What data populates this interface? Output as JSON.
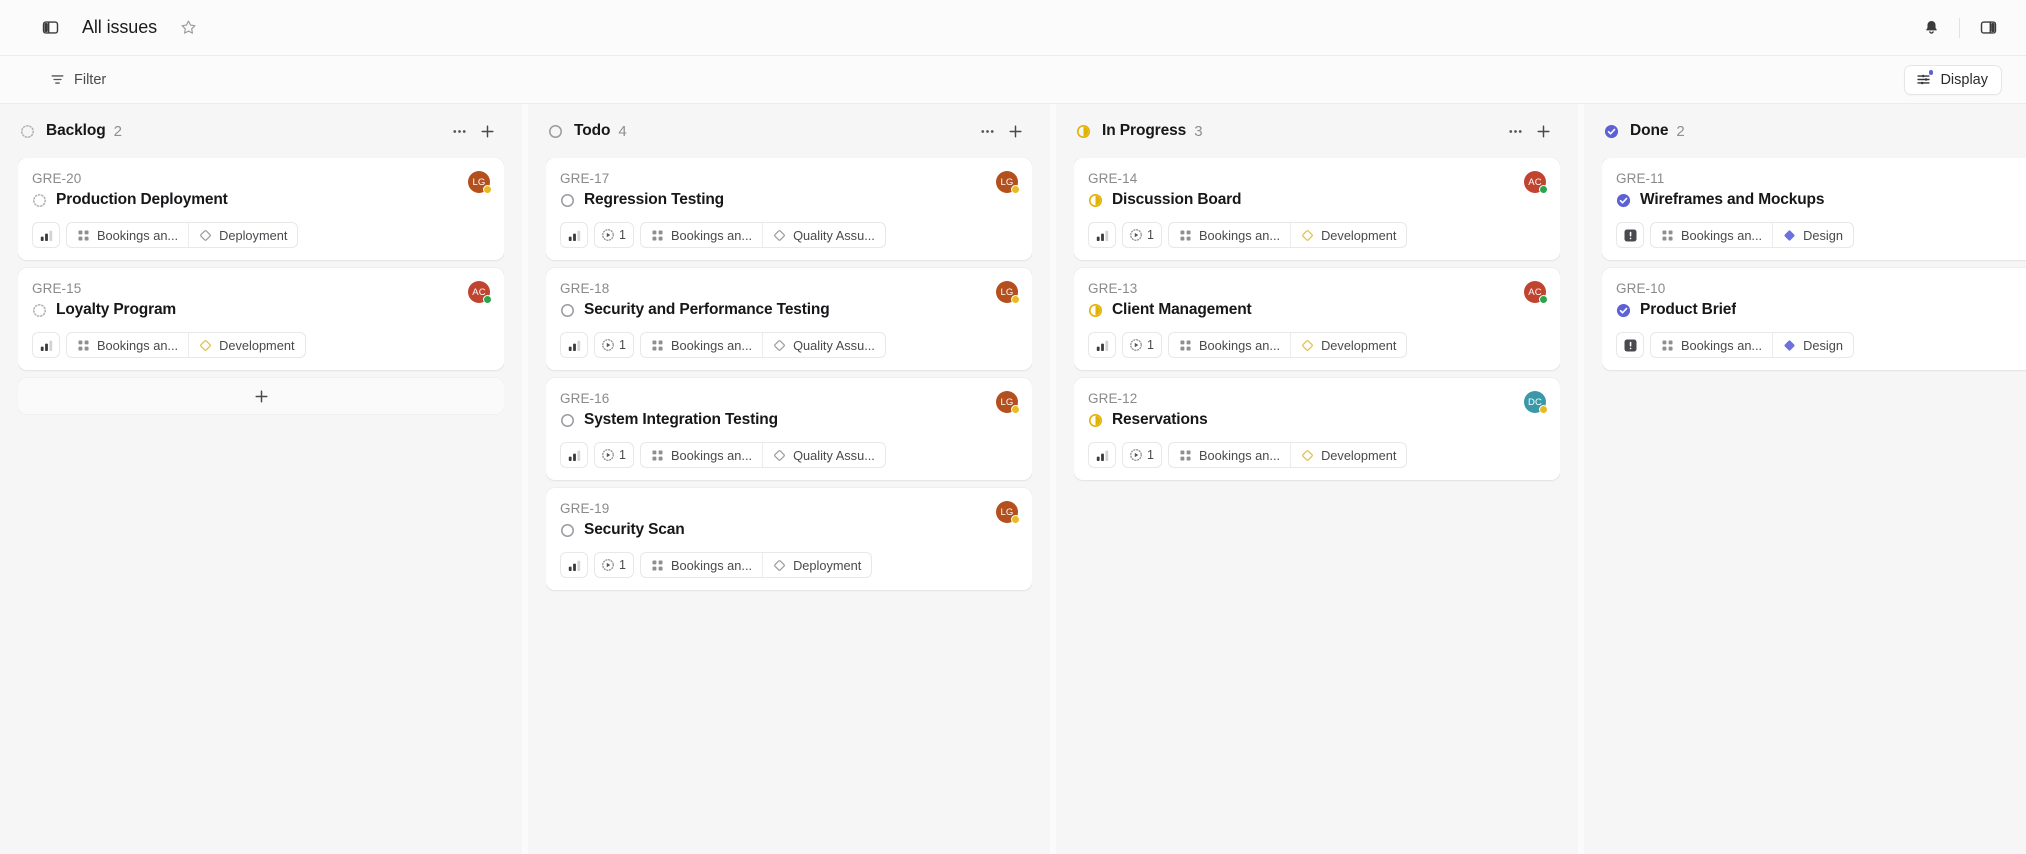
{
  "topbar": {
    "sidebar_toggle_icon": "panel-left-icon",
    "title": "All issues",
    "favorite_icon": "star-icon",
    "notifications_icon": "bell-icon",
    "right_panel_icon": "panel-right-icon"
  },
  "filterbar": {
    "filter_icon": "filter-icon",
    "filter_label": "Filter",
    "display_icon": "sliders-icon",
    "display_label": "Display",
    "display_badge_color": "#5c62d6"
  },
  "colors": {
    "backlog": "#b0b0b5",
    "todo": "#9a9aa0",
    "in_progress": "#e2b203",
    "done": "#5c62d6",
    "label_design": "#6b72e0",
    "label_development": "#e2c044",
    "label_generic": "#9c9ca2",
    "avatar_lg": "#b44f1e",
    "avatar_ac": "#c0442f",
    "avatar_dc": "#3a98a8",
    "presence_online": "#2aa44f",
    "presence_away": "#e8b923",
    "urgent_bg": "#4a4a4e"
  },
  "columns": [
    {
      "id": "backlog",
      "status_icon": "backlog-dotted-circle-icon",
      "title": "Backlog",
      "count": "2",
      "more_icon": "ellipsis-icon",
      "add_icon": "plus-icon",
      "add_card_label": "+",
      "has_add_card_row": true,
      "cards": [
        {
          "id": "GRE-20",
          "title": "Production Deployment",
          "status_icon": "backlog-dotted-circle-icon",
          "priority": "medium",
          "priority_icon": "priority-bars-icon",
          "sub_count": null,
          "avatar": {
            "initials": "LG",
            "color_key": "avatar_lg",
            "presence": "away"
          },
          "labels": [
            {
              "text": "Bookings an...",
              "icon": "project-grid-icon",
              "color_key": "label_generic"
            },
            {
              "text": "Deployment",
              "icon": "diamond-icon",
              "color_key": "label_generic"
            }
          ]
        },
        {
          "id": "GRE-15",
          "title": "Loyalty Program",
          "status_icon": "backlog-dotted-circle-icon",
          "priority": "medium",
          "priority_icon": "priority-bars-icon",
          "sub_count": null,
          "avatar": {
            "initials": "AC",
            "color_key": "avatar_ac",
            "presence": "online"
          },
          "labels": [
            {
              "text": "Bookings an...",
              "icon": "project-grid-icon",
              "color_key": "label_generic"
            },
            {
              "text": "Development",
              "icon": "diamond-icon",
              "color_key": "label_development"
            }
          ]
        }
      ]
    },
    {
      "id": "todo",
      "status_icon": "todo-circle-icon",
      "title": "Todo",
      "count": "4",
      "more_icon": "ellipsis-icon",
      "add_icon": "plus-icon",
      "has_add_card_row": false,
      "cards": [
        {
          "id": "GRE-17",
          "title": "Regression Testing",
          "status_icon": "todo-circle-icon",
          "priority": "medium",
          "priority_icon": "priority-bars-icon",
          "sub_count": "1",
          "sub_icon": "sub-issue-progress-icon",
          "avatar": {
            "initials": "LG",
            "color_key": "avatar_lg",
            "presence": "away"
          },
          "labels": [
            {
              "text": "Bookings an...",
              "icon": "project-grid-icon",
              "color_key": "label_generic"
            },
            {
              "text": "Quality Assu...",
              "icon": "diamond-icon",
              "color_key": "label_generic"
            }
          ]
        },
        {
          "id": "GRE-18",
          "title": "Security and Performance Testing",
          "status_icon": "todo-circle-icon",
          "priority": "medium",
          "priority_icon": "priority-bars-icon",
          "sub_count": "1",
          "sub_icon": "sub-issue-progress-icon",
          "avatar": {
            "initials": "LG",
            "color_key": "avatar_lg",
            "presence": "away"
          },
          "labels": [
            {
              "text": "Bookings an...",
              "icon": "project-grid-icon",
              "color_key": "label_generic"
            },
            {
              "text": "Quality Assu...",
              "icon": "diamond-icon",
              "color_key": "label_generic"
            }
          ]
        },
        {
          "id": "GRE-16",
          "title": "System Integration Testing",
          "status_icon": "todo-circle-icon",
          "priority": "medium",
          "priority_icon": "priority-bars-icon",
          "sub_count": "1",
          "sub_icon": "sub-issue-progress-icon",
          "avatar": {
            "initials": "LG",
            "color_key": "avatar_lg",
            "presence": "away"
          },
          "labels": [
            {
              "text": "Bookings an...",
              "icon": "project-grid-icon",
              "color_key": "label_generic"
            },
            {
              "text": "Quality Assu...",
              "icon": "diamond-icon",
              "color_key": "label_generic"
            }
          ]
        },
        {
          "id": "GRE-19",
          "title": "Security Scan",
          "status_icon": "todo-circle-icon",
          "priority": "medium",
          "priority_icon": "priority-bars-icon",
          "sub_count": "1",
          "sub_icon": "sub-issue-progress-icon",
          "avatar": {
            "initials": "LG",
            "color_key": "avatar_lg",
            "presence": "away"
          },
          "labels": [
            {
              "text": "Bookings an...",
              "icon": "project-grid-icon",
              "color_key": "label_generic"
            },
            {
              "text": "Deployment",
              "icon": "diamond-icon",
              "color_key": "label_generic"
            }
          ]
        }
      ]
    },
    {
      "id": "in-progress",
      "status_icon": "in-progress-half-circle-icon",
      "title": "In Progress",
      "count": "3",
      "more_icon": "ellipsis-icon",
      "add_icon": "plus-icon",
      "has_add_card_row": false,
      "cards": [
        {
          "id": "GRE-14",
          "title": "Discussion Board",
          "status_icon": "in-progress-half-circle-icon",
          "priority": "medium",
          "priority_icon": "priority-bars-icon",
          "sub_count": "1",
          "sub_icon": "sub-issue-progress-icon",
          "avatar": {
            "initials": "AC",
            "color_key": "avatar_ac",
            "presence": "online"
          },
          "labels": [
            {
              "text": "Bookings an...",
              "icon": "project-grid-icon",
              "color_key": "label_generic"
            },
            {
              "text": "Development",
              "icon": "diamond-icon",
              "color_key": "label_development"
            }
          ]
        },
        {
          "id": "GRE-13",
          "title": "Client Management",
          "status_icon": "in-progress-half-circle-icon",
          "priority": "medium",
          "priority_icon": "priority-bars-icon",
          "sub_count": "1",
          "sub_icon": "sub-issue-progress-icon",
          "avatar": {
            "initials": "AC",
            "color_key": "avatar_ac",
            "presence": "online"
          },
          "labels": [
            {
              "text": "Bookings an...",
              "icon": "project-grid-icon",
              "color_key": "label_generic"
            },
            {
              "text": "Development",
              "icon": "diamond-icon",
              "color_key": "label_development"
            }
          ]
        },
        {
          "id": "GRE-12",
          "title": "Reservations",
          "status_icon": "in-progress-half-circle-icon",
          "priority": "medium",
          "priority_icon": "priority-bars-icon",
          "sub_count": "1",
          "sub_icon": "sub-issue-progress-icon",
          "avatar": {
            "initials": "DC",
            "color_key": "avatar_dc",
            "presence": "away"
          },
          "labels": [
            {
              "text": "Bookings an...",
              "icon": "project-grid-icon",
              "color_key": "label_generic"
            },
            {
              "text": "Development",
              "icon": "diamond-icon",
              "color_key": "label_development"
            }
          ]
        }
      ]
    },
    {
      "id": "done",
      "status_icon": "done-check-circle-icon",
      "title": "Done",
      "count": "2",
      "more_icon": "ellipsis-icon",
      "add_icon": null,
      "has_add_card_row": false,
      "cards": [
        {
          "id": "GRE-11",
          "title": "Wireframes and Mockups",
          "status_icon": "done-check-circle-icon",
          "priority": "urgent",
          "priority_icon": "priority-urgent-icon",
          "sub_count": null,
          "avatar": null,
          "labels": [
            {
              "text": "Bookings an...",
              "icon": "project-grid-icon",
              "color_key": "label_generic"
            },
            {
              "text": "Design",
              "icon": "diamond-icon",
              "color_key": "label_design"
            }
          ]
        },
        {
          "id": "GRE-10",
          "title": "Product Brief",
          "status_icon": "done-check-circle-icon",
          "priority": "urgent",
          "priority_icon": "priority-urgent-icon",
          "sub_count": null,
          "avatar": null,
          "labels": [
            {
              "text": "Bookings an...",
              "icon": "project-grid-icon",
              "color_key": "label_generic"
            },
            {
              "text": "Design",
              "icon": "diamond-icon",
              "color_key": "label_design"
            }
          ]
        }
      ]
    }
  ]
}
